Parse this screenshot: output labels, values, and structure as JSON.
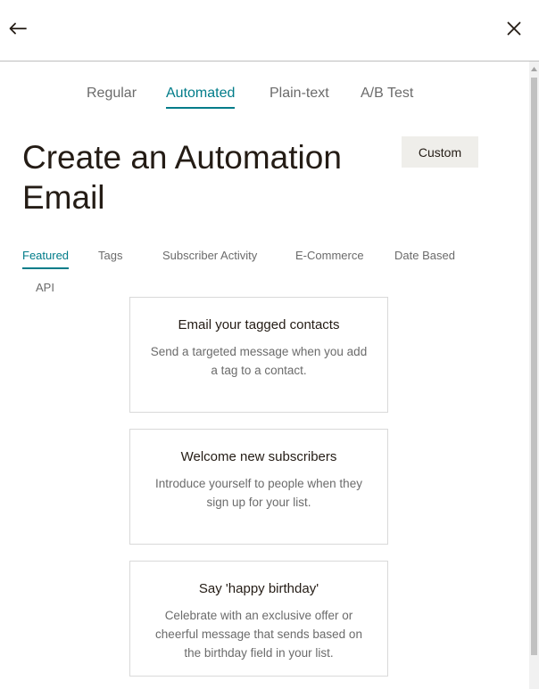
{
  "header": {
    "back_icon": "arrow-left-icon",
    "close_icon": "close-icon"
  },
  "type_tabs": [
    {
      "label": "Regular",
      "active": false
    },
    {
      "label": "Automated",
      "active": true
    },
    {
      "label": "Plain-text",
      "active": false
    },
    {
      "label": "A/B Test",
      "active": false
    }
  ],
  "main": {
    "title": "Create an Automation Email",
    "custom_label": "Custom"
  },
  "category_tabs": [
    {
      "label": "Featured",
      "active": true
    },
    {
      "label": "Tags",
      "active": false
    },
    {
      "label": "Subscriber Activity",
      "active": false
    },
    {
      "label": "E-Commerce",
      "active": false
    },
    {
      "label": "Date Based",
      "active": false
    },
    {
      "label": "API",
      "active": false
    }
  ],
  "cards": [
    {
      "title": "Email your tagged contacts",
      "description": "Send a targeted message when you add a tag to a contact."
    },
    {
      "title": "Welcome new subscribers",
      "description": "Introduce yourself to people when they sign up for your list."
    },
    {
      "title": "Say 'happy birthday'",
      "description": "Celebrate with an exclusive offer or cheerful message that sends based on the birthday field in your list."
    }
  ],
  "colors": {
    "accent": "#007c89",
    "text": "#241c15",
    "muted": "#6b6b6b",
    "button_bg": "#efeeea"
  }
}
